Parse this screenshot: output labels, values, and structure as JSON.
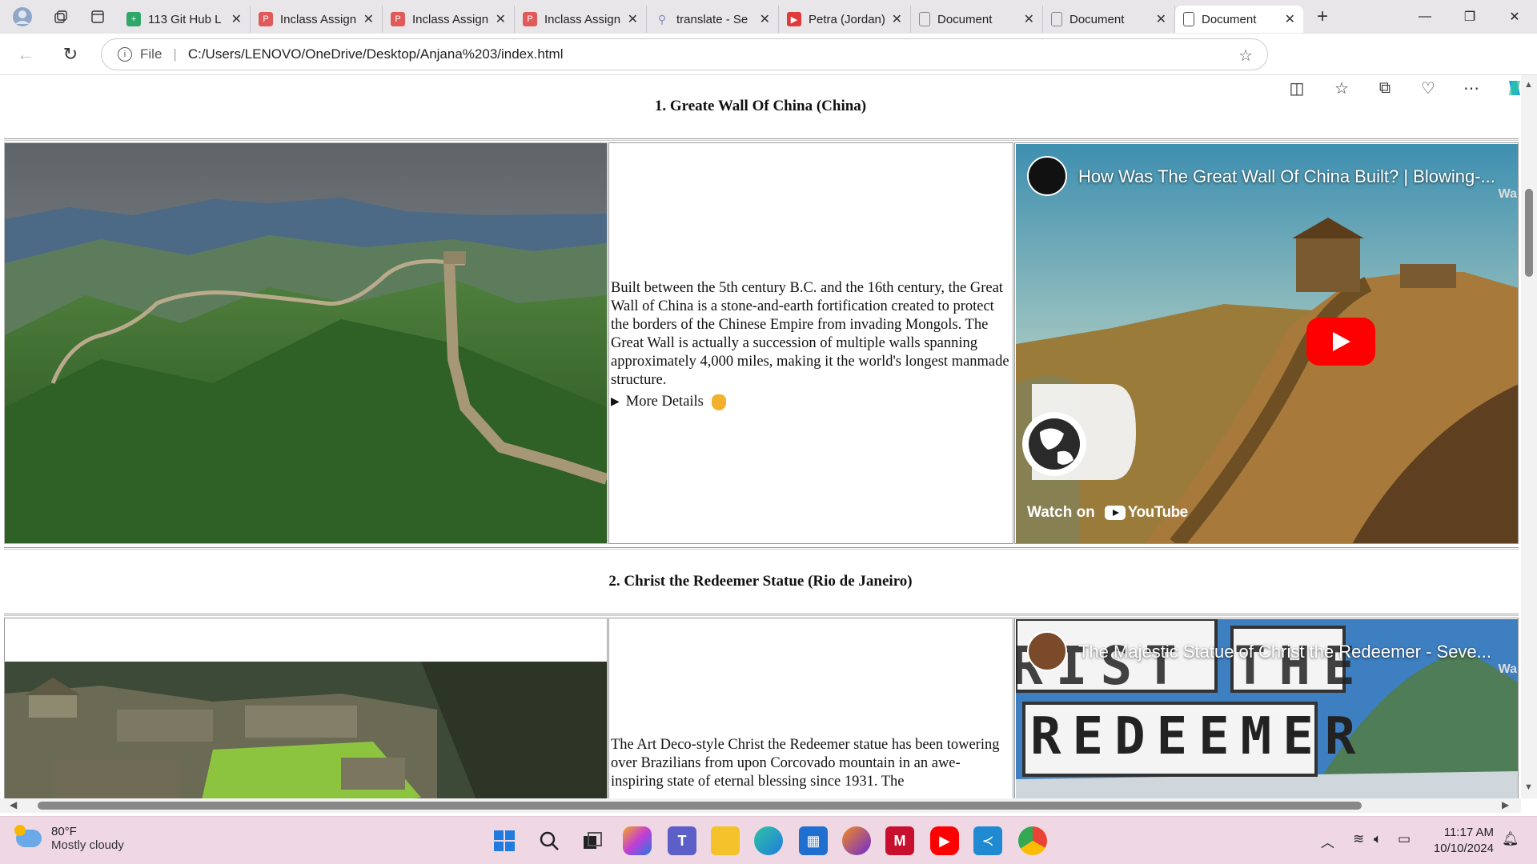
{
  "browser": {
    "tabs": [
      {
        "label": "113 Git Hub L",
        "favicon_color": "#2fa76a",
        "favicon": "sheet-icon"
      },
      {
        "label": "Inclass Assign",
        "favicon_color": "#e05a5a",
        "favicon": "pdf-icon"
      },
      {
        "label": "Inclass Assign",
        "favicon_color": "#e05a5a",
        "favicon": "pdf-icon"
      },
      {
        "label": "Inclass Assign",
        "favicon_color": "#e05a5a",
        "favicon": "pdf-icon"
      },
      {
        "label": "translate - Se",
        "favicon_color": "#7a8fb8",
        "favicon": "search-icon"
      },
      {
        "label": "Petra (Jordan)",
        "favicon_color": "#e03a3a",
        "favicon": "youtube-icon"
      },
      {
        "label": "Document",
        "favicon_color": "#888888",
        "favicon": "document-icon"
      },
      {
        "label": "Document",
        "favicon_color": "#888888",
        "favicon": "document-icon"
      },
      {
        "label": "Document",
        "favicon_color": "#888888",
        "favicon": "document-icon",
        "active": true
      }
    ],
    "address": {
      "scheme_label": "File",
      "url": "C:/Users/LENOVO/OneDrive/Desktop/Anjana%203/index.html"
    }
  },
  "page": {
    "sections": [
      {
        "heading": "1. Greate Wall Of China (China)",
        "description": "Built between the 5th century B.C. and the 16th century, the Great Wall of China is a stone-and-earth fortification created to protect the borders of the Chinese Empire from invading Mongols. The Great Wall is actually a succession of multiple walls spanning approximately 4,000 miles, making it the world's longest manmade structure.",
        "details_label": "More Details",
        "video_title": "How Was The Great Wall Of China Built? | Blowing-...",
        "video_side_label": "Wa",
        "watch_label": "Watch on",
        "youtube_label": "YouTube"
      },
      {
        "heading": "2. Christ the Redeemer Statue (Rio de Janeiro)",
        "description": "The Art Deco-style Christ the Redeemer statue has been towering over Brazilians from upon Corcovado mountain in an awe-inspiring state of eternal blessing since 1931. The",
        "video_title": "The Majestic Statue of Christ the Redeemer - Seve...",
        "video_side_label": "Wa",
        "thumb_line1": "RIST THE",
        "thumb_line2": "REDEEMER"
      }
    ]
  },
  "taskbar": {
    "weather_temp": "80°F",
    "weather_text": "Mostly cloudy",
    "time": "11:17 AM",
    "date": "10/10/2024"
  },
  "colors": {
    "tabbar_bg": "#e9e6ea",
    "taskbar_bg": "#efd8e4",
    "youtube_red": "#ff0000"
  }
}
